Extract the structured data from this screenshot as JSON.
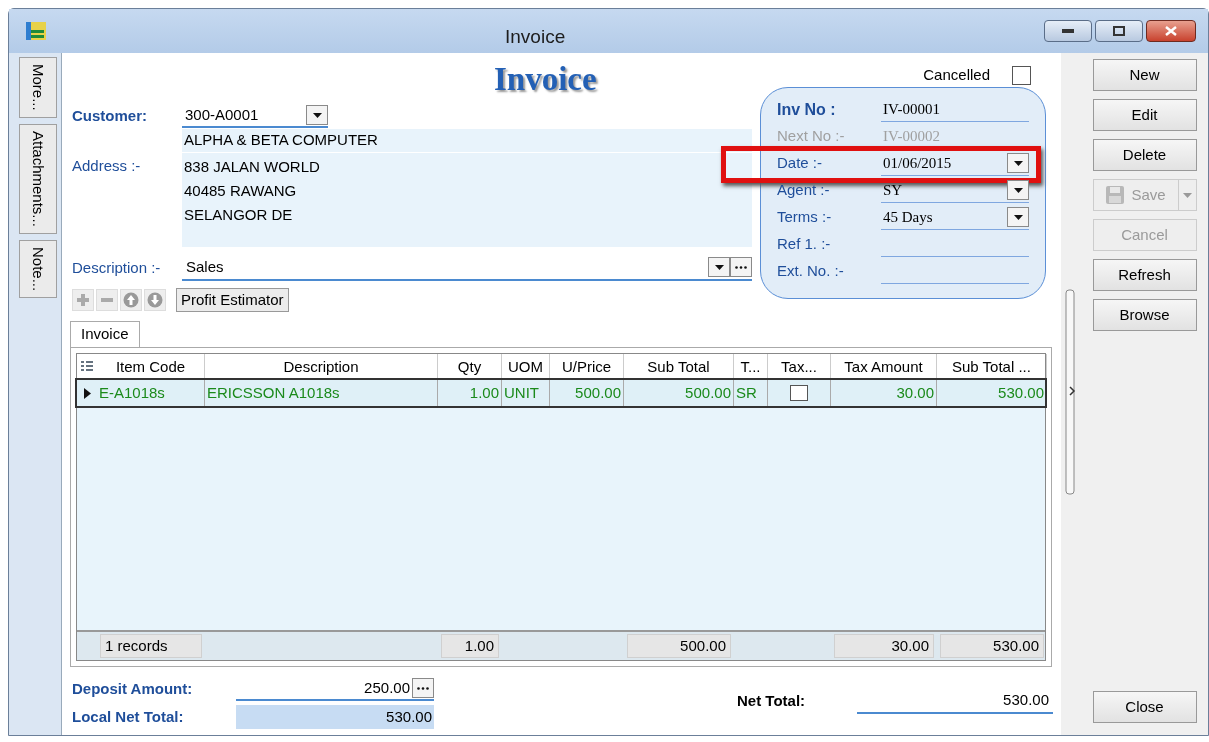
{
  "window": {
    "title": "Invoice"
  },
  "side_tabs": [
    {
      "label": "More..."
    },
    {
      "label": "Attachments..."
    },
    {
      "label": "Note..."
    }
  ],
  "form": {
    "heading": "Invoice",
    "cancelled": {
      "label": "Cancelled",
      "checked": false
    },
    "customer": {
      "label": "Customer:",
      "value": "300-A0001"
    },
    "company_name": "ALPHA & BETA COMPUTER",
    "address": {
      "label": "Address :-",
      "lines": [
        "838 JALAN WORLD",
        "40485 RAWANG",
        "SELANGOR DE"
      ]
    },
    "description": {
      "label": "Description :-",
      "value": "Sales"
    },
    "profit_estimator": "Profit Estimator",
    "tabs": [
      {
        "label": "Invoice",
        "selected": true
      }
    ]
  },
  "info_panel": [
    {
      "label": "Inv No :",
      "value": "IV-00001",
      "kind": "title",
      "disabled": false,
      "highlighted": false
    },
    {
      "label": "Next No :-",
      "value": "IV-00002",
      "kind": "text",
      "disabled": true,
      "highlighted": false
    },
    {
      "label": "Date :-",
      "value": "01/06/2015",
      "kind": "dropdown",
      "disabled": false,
      "highlighted": true
    },
    {
      "label": "Agent :-",
      "value": "SY",
      "kind": "dropdown",
      "disabled": false,
      "highlighted": false
    },
    {
      "label": "Terms :-",
      "value": "45 Days",
      "kind": "dropdown",
      "disabled": false,
      "highlighted": false
    },
    {
      "label": "Ref 1. :-",
      "kind": "text",
      "disabled": false,
      "highlighted": false
    },
    {
      "label": "Ext. No. :-",
      "kind": "text",
      "disabled": false,
      "highlighted": false
    }
  ],
  "table": {
    "columns": [
      "Item Code",
      "Description",
      "Qty",
      "UOM",
      "U/Price",
      "Sub Total",
      "T...",
      "Tax...",
      "Tax Amount",
      "Sub Total ..."
    ],
    "rows": [
      {
        "selected": true,
        "item_code": "E-A1018s",
        "description": "ERICSSON A1018s",
        "qty": "1.00",
        "uom": "UNIT",
        "u_price": "500.00",
        "sub_total": "500.00",
        "tax_code": "SR",
        "tax_inclusive": false,
        "tax_amount": "30.00",
        "sub_total_with_tax": "530.00"
      }
    ],
    "footer": {
      "records": "1 records",
      "qty": "1.00",
      "sub_total": "500.00",
      "tax_amount": "30.00",
      "sub_total_with_tax": "530.00"
    }
  },
  "totals": {
    "deposit": {
      "label": "Deposit Amount:",
      "value": "250.00"
    },
    "local_net_total": {
      "label": "Local Net Total:",
      "value": "530.00"
    },
    "net_total": {
      "label": "Net Total:",
      "value": "530.00"
    }
  },
  "buttons": [
    {
      "label": "New",
      "disabled": false,
      "kind": "plain"
    },
    {
      "label": "Edit",
      "disabled": false,
      "kind": "plain"
    },
    {
      "label": "Delete",
      "disabled": false,
      "kind": "plain"
    },
    {
      "label": "Save",
      "disabled": true,
      "kind": "split"
    },
    {
      "label": "Cancel",
      "disabled": true,
      "kind": "plain"
    },
    {
      "label": "Refresh",
      "disabled": false,
      "kind": "plain"
    },
    {
      "label": "Browse",
      "disabled": false,
      "kind": "plain"
    }
  ],
  "close_button": "Close"
}
